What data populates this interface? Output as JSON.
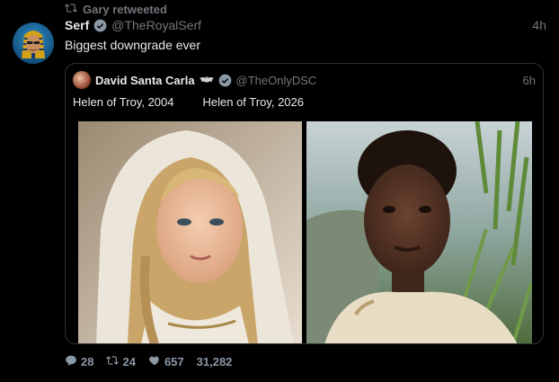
{
  "retweet": {
    "text": "Gary retweeted"
  },
  "tweet": {
    "name": "Serf",
    "handle": "@TheRoyalSerf",
    "time": "4h",
    "text": "Biggest downgrade ever"
  },
  "quote": {
    "name": "David Santa Carla",
    "handle": "@TheOnlyDSC",
    "time": "6h",
    "caption_left": "Helen of Troy, 2004",
    "caption_right": "Helen of Troy, 2026"
  },
  "stats": {
    "replies": "28",
    "retweets": "24",
    "likes": "657",
    "views": "31,282"
  },
  "colors": {
    "background": "#000000",
    "text": "#e7e9ea",
    "muted": "#71767b",
    "verified": "#8b98a5",
    "like": "#8b98a5"
  }
}
